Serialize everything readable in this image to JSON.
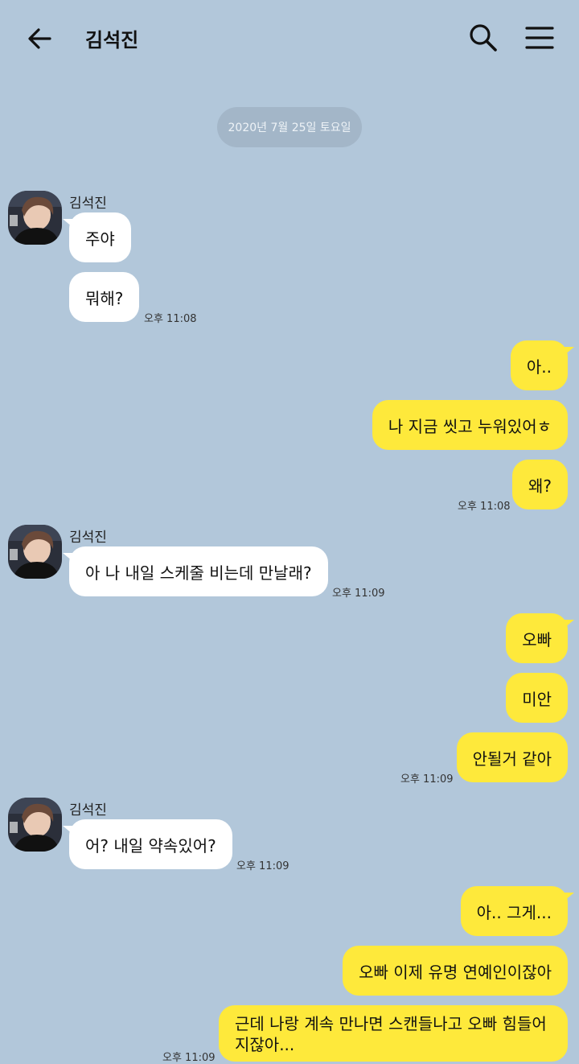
{
  "header": {
    "title": "김석진",
    "back_icon": "arrow-left-icon",
    "search_icon": "search-icon",
    "menu_icon": "hamburger-menu-icon"
  },
  "date_divider": "2020년 7월 25일 토요일",
  "colors": {
    "background": "#b2c7da",
    "incoming_bubble": "#ffffff",
    "outgoing_bubble": "#fee93b",
    "date_pill": "#a3b6c8"
  },
  "messages": {
    "g1": {
      "sender": "김석진",
      "m1": "주야",
      "m2": "뭐해?",
      "time": "오후 11:08"
    },
    "g2": {
      "m1": "아..",
      "m2": "나 지금 씻고 누워있어ㅎ",
      "m3": "왜?",
      "time": "오후 11:08"
    },
    "g3": {
      "sender": "김석진",
      "m1": "아 나 내일 스케줄 비는데 만날래?",
      "time": "오후 11:09"
    },
    "g4": {
      "m1": "오빠",
      "m2": "미안",
      "m3": "안될거 같아",
      "time": "오후 11:09"
    },
    "g5": {
      "sender": "김석진",
      "m1": "어? 내일 약속있어?",
      "time": "오후 11:09"
    },
    "g6": {
      "m1": "아.. 그게...",
      "m2": "오빠 이제 유명 연예인이잖아",
      "m3": "근데 나랑 계속 만나면 스캔들나고 오빠 힘들어 지잖아...",
      "time": "오후 11:09"
    }
  }
}
